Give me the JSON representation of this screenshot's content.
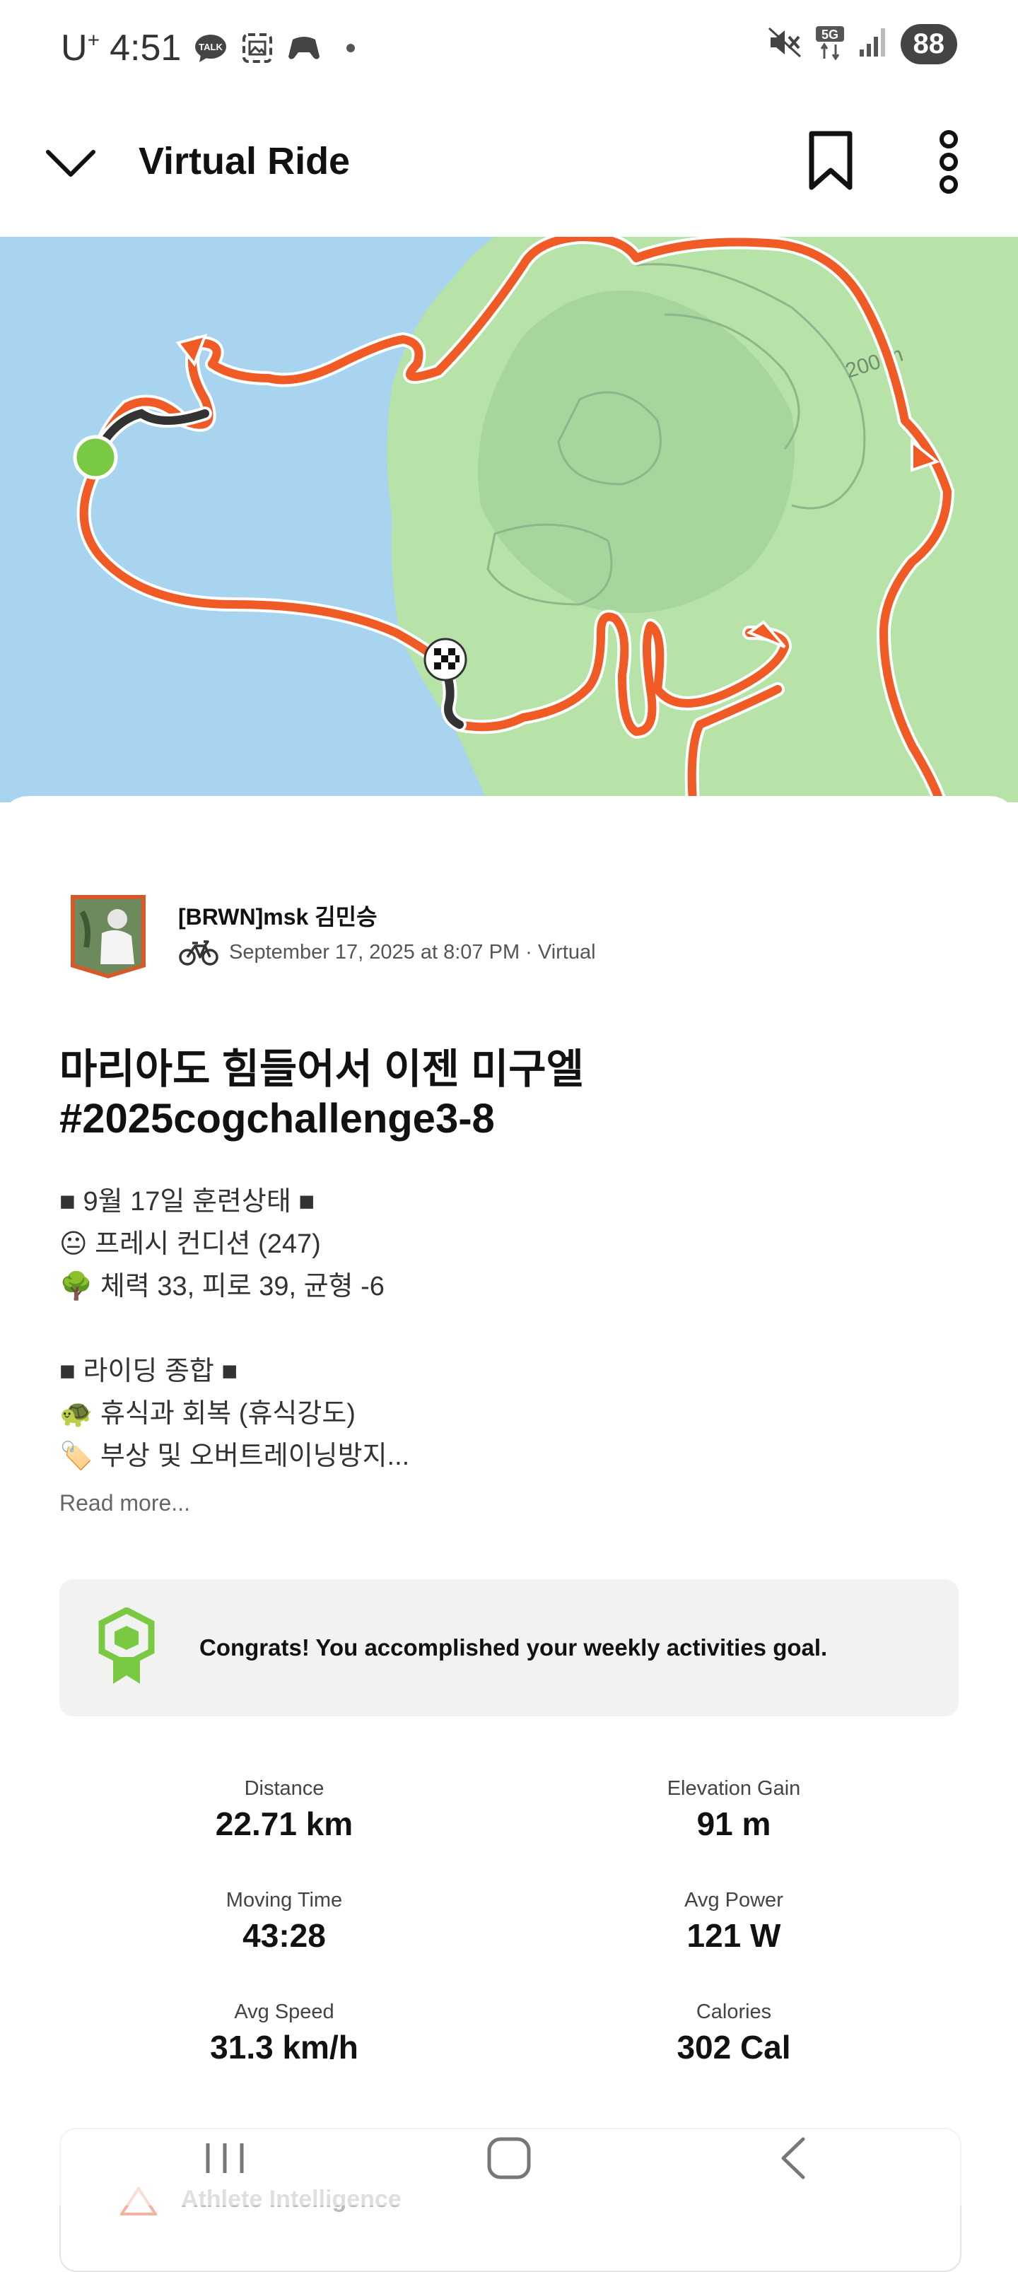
{
  "status_bar": {
    "carrier": "U",
    "carrier_sup": "+",
    "time": "4:51",
    "network": "5G",
    "battery": "88"
  },
  "header": {
    "title": "Virtual Ride",
    "icons": [
      "chevron-down-icon",
      "bookmark-icon",
      "more-vertical-icon"
    ]
  },
  "map": {
    "elevation_label": "200 m",
    "colors": {
      "water": "#a8d4f0",
      "land": "#b7e2a8",
      "route": "#ef5a25",
      "start": "#7ac943"
    }
  },
  "activity": {
    "athlete_name": "[BRWN]msk 김민승",
    "meta": "September 17, 2025 at 8:07 PM · Virtual",
    "title_line1": "마리아도 힘들어서 이젠 미구엘",
    "title_line2": "#2025cogchallenge3-8",
    "description": [
      "■ 9월 17일 훈련상태 ■",
      "😐 프레시 컨디션 (247)",
      "🌳 체력 33, 피로 39, 균형 -6",
      "",
      "■ 라이딩 종합 ■",
      "🐢 휴식과 회복 (휴식강도)",
      "🏷️ 부상 및 오버트레이닝방지..."
    ],
    "read_more": "Read more..."
  },
  "goal_banner": {
    "text": "Congrats! You accomplished your weekly activities goal."
  },
  "stats": [
    {
      "label": "Distance",
      "value": "22.71 km"
    },
    {
      "label": "Elevation Gain",
      "value": "91 m"
    },
    {
      "label": "Moving Time",
      "value": "43:28"
    },
    {
      "label": "Avg Power",
      "value": "121 W"
    },
    {
      "label": "Avg Speed",
      "value": "31.3 km/h"
    },
    {
      "label": "Calories",
      "value": "302 Cal"
    }
  ],
  "bottom_card": {
    "label": "Athlete Intelligence"
  }
}
